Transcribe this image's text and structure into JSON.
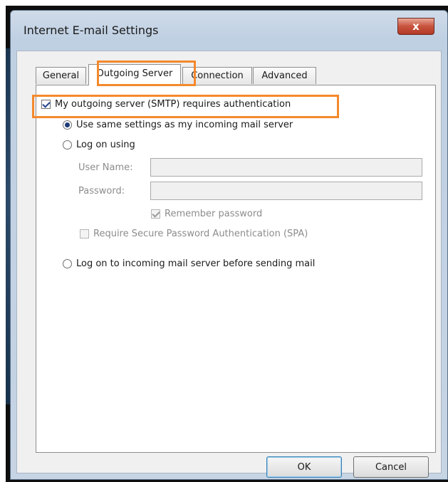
{
  "dialog": {
    "title": "Internet E-mail Settings",
    "close_glyph": "x"
  },
  "tabs": [
    {
      "label": "General",
      "active": false
    },
    {
      "label": "Outgoing Server",
      "active": true
    },
    {
      "label": "Connection",
      "active": false
    },
    {
      "label": "Advanced",
      "active": false
    }
  ],
  "outgoing": {
    "requires_auth_label": "My outgoing server (SMTP) requires authentication",
    "requires_auth_checked": true,
    "same_settings_label": "Use same settings as my incoming mail server",
    "logon_using_label": "Log on using",
    "username_label": "User Name:",
    "username_value": "",
    "password_label": "Password:",
    "password_value": "",
    "remember_password_label": "Remember password",
    "remember_password_checked": true,
    "spa_label": "Require Secure Password Authentication (SPA)",
    "spa_checked": false,
    "logon_incoming_first_label": "Log on to incoming mail server before sending mail"
  },
  "buttons": {
    "ok_label": "OK",
    "cancel_label": "Cancel"
  },
  "colors": {
    "highlight": "#f4892c",
    "window_frame": "#c6d4e4",
    "close_button": "#c8533d"
  },
  "icons": {
    "close": "close-icon"
  }
}
